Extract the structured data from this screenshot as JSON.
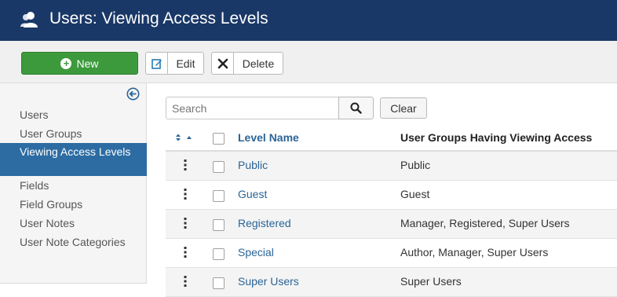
{
  "header": {
    "title": "Users: Viewing Access Levels",
    "icon": "users-icon"
  },
  "toolbar": {
    "new_label": "New",
    "edit_label": "Edit",
    "delete_label": "Delete"
  },
  "sidebar": {
    "items": [
      {
        "label": "Users",
        "active": false
      },
      {
        "label": "User Groups",
        "active": false
      },
      {
        "label": "Viewing Access Levels",
        "active": true
      },
      {
        "label": "Fields",
        "active": false
      },
      {
        "label": "Field Groups",
        "active": false
      },
      {
        "label": "User Notes",
        "active": false
      },
      {
        "label": "User Note Categories",
        "active": false
      }
    ]
  },
  "search": {
    "placeholder": "Search",
    "clear_label": "Clear"
  },
  "table": {
    "col_level": "Level Name",
    "col_groups": "User Groups Having Viewing Access",
    "rows": [
      {
        "level": "Public",
        "groups": "Public"
      },
      {
        "level": "Guest",
        "groups": "Guest"
      },
      {
        "level": "Registered",
        "groups": "Manager, Registered, Super Users"
      },
      {
        "level": "Special",
        "groups": "Author, Manager, Super Users"
      },
      {
        "level": "Super Users",
        "groups": "Super Users"
      }
    ]
  },
  "colors": {
    "header_bg": "#1a3867",
    "new_button": "#3c9a3c",
    "active_item": "#2d6ca2",
    "link": "#2a6496"
  }
}
